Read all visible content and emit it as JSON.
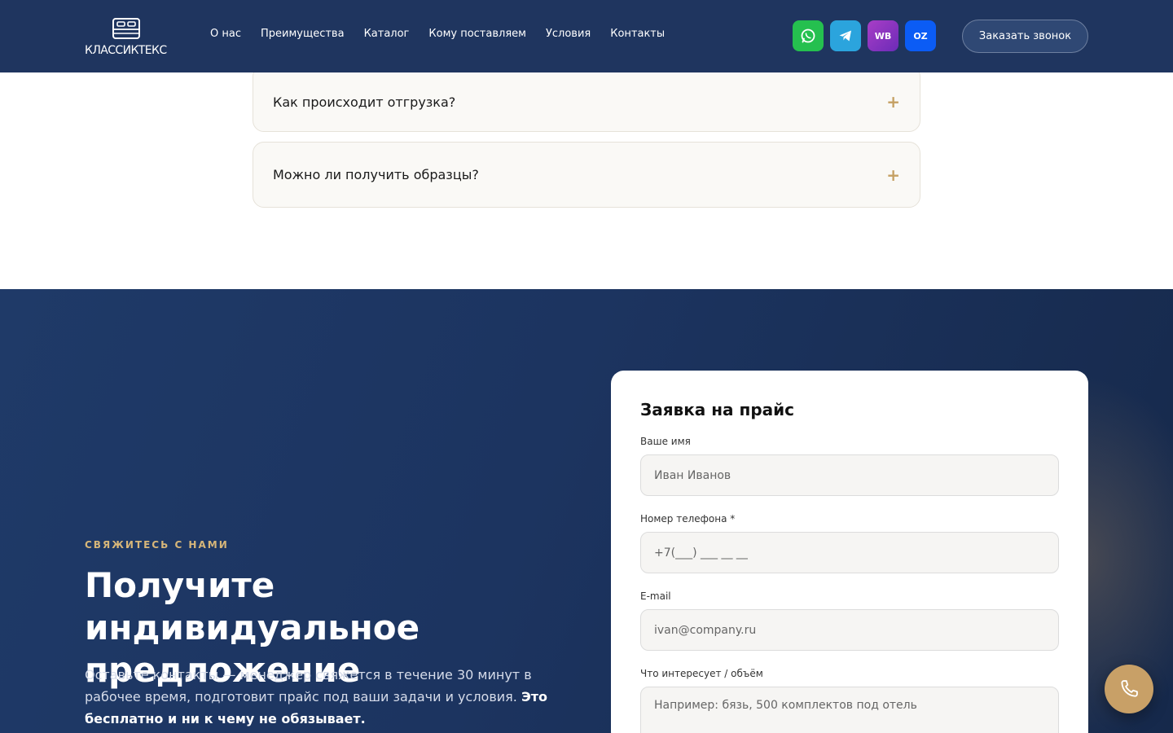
{
  "header": {
    "logo_text": "КЛАССИКТЕКС",
    "nav": [
      {
        "label": "О нас"
      },
      {
        "label": "Преимущества"
      },
      {
        "label": "Каталог"
      },
      {
        "label": "Кому поставляем"
      },
      {
        "label": "Условия"
      },
      {
        "label": "Контакты"
      }
    ],
    "socials": {
      "whatsapp_icon": "whatsapp-icon",
      "telegram_icon": "telegram-icon",
      "wb_label": "WB",
      "oz_label": "OZ"
    },
    "callback_label": "Заказать звонок"
  },
  "faq": [
    {
      "question": "Как происходит отгрузка?"
    },
    {
      "question": "Можно ли получить образцы?"
    }
  ],
  "contact": {
    "eyebrow": "СВЯЖИТЕСЬ С НАМИ",
    "title": "Получите индивидуальное предложение",
    "lead_text": "Оставьте контакты — менеджер свяжется в течение 30 минут в рабочее время, подготовит прайс под ваши задачи и условия. ",
    "lead_bold": "Это бесплатно и ни к чему не обязывает."
  },
  "form": {
    "title": "Заявка на прайс",
    "name_label": "Ваше имя",
    "name_placeholder": "Иван Иванов",
    "phone_label": "Номер телефона *",
    "phone_placeholder": "+7(___) ___ __ __",
    "email_label": "E-mail",
    "email_placeholder": "ivan@company.ru",
    "interest_label": "Что интересует / объём",
    "interest_placeholder": "Например: бязь, 500 комплектов под отель"
  },
  "colors": {
    "header_bg": "#1f355f",
    "accent_gold": "#c8a067",
    "whatsapp": "#25c04f",
    "telegram": "#2ba4dd",
    "wb": "#a83ec6",
    "ozon": "#0b5cf5"
  },
  "float_button_icon": "phone-icon"
}
